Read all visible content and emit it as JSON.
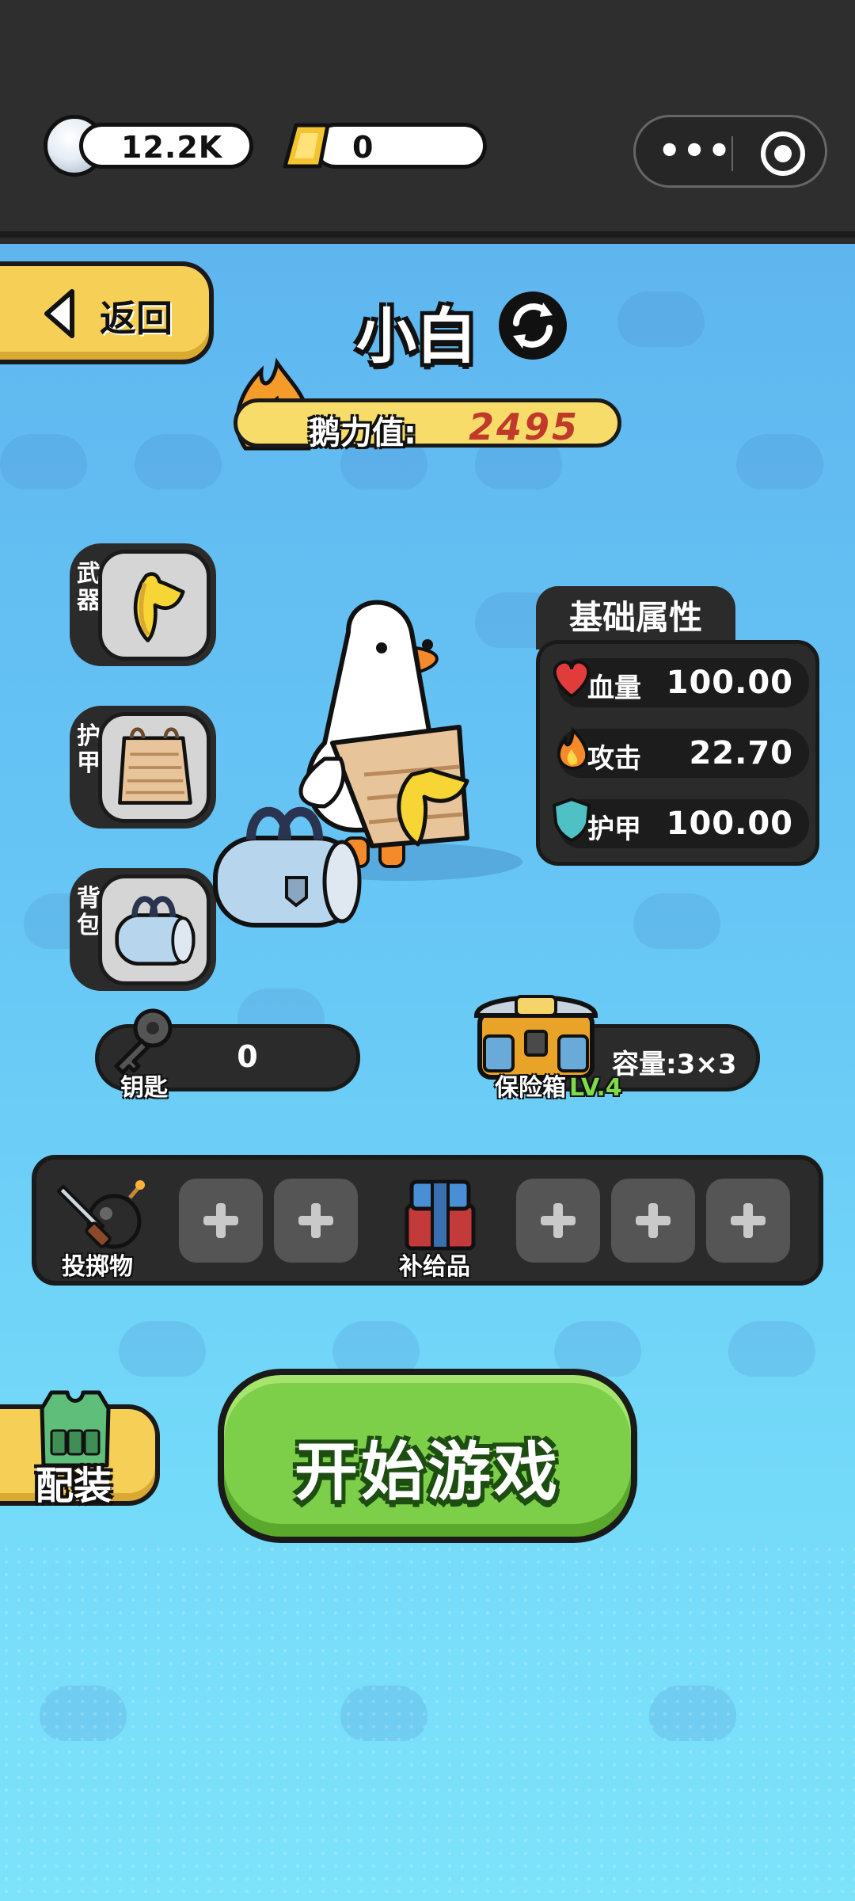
{
  "header": {
    "silver": "12.2K",
    "gold": "0"
  },
  "back_label": "返回",
  "character": {
    "name": "小白",
    "power_label": "鹅力值:",
    "power_value": "2495"
  },
  "slots": [
    {
      "label": "武器"
    },
    {
      "label": "护甲"
    },
    {
      "label": "背包"
    }
  ],
  "stats": {
    "title": "基础属性",
    "rows": [
      {
        "label": "血量",
        "value": "100.00",
        "icon": "heart-icon"
      },
      {
        "label": "攻击",
        "value": "22.70",
        "icon": "fire-icon"
      },
      {
        "label": "护甲",
        "value": "100.00",
        "icon": "shield-icon"
      }
    ]
  },
  "keys": {
    "label": "钥匙",
    "value": "0"
  },
  "vault": {
    "label": "保险箱",
    "level": "LV.4",
    "capacity": "容量:3×3"
  },
  "items": {
    "throwables_label": "投掷物",
    "supplies_label": "补给品"
  },
  "equip_label": "配装",
  "start_label": "开始游戏",
  "colors": {
    "accent_yellow": "#f6cf57",
    "start_green": "#7dcf4a",
    "power_red": "#c0392b",
    "level_green": "#7ddc4a"
  }
}
